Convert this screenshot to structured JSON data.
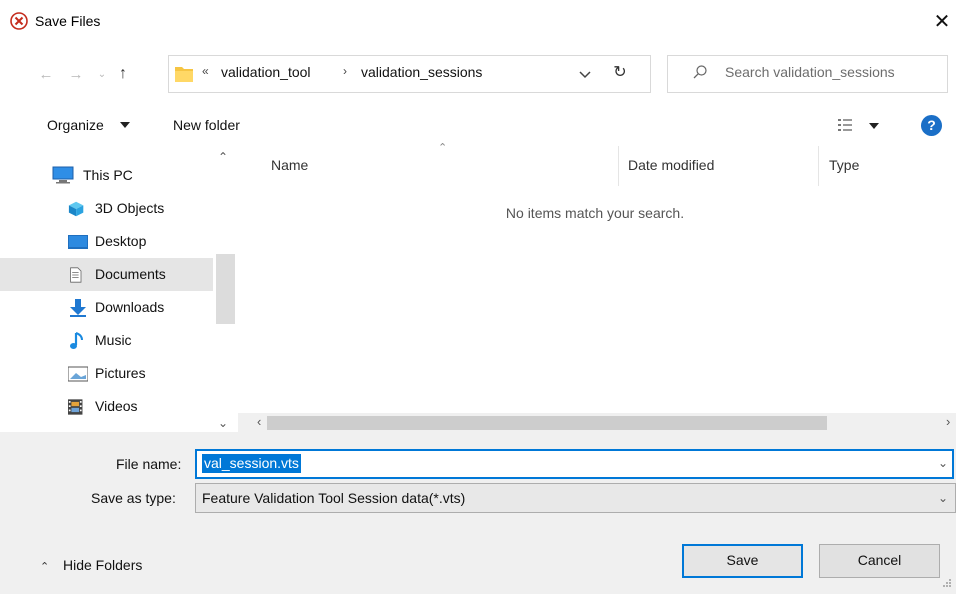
{
  "window": {
    "title": "Save Files",
    "close_glyph": "✕"
  },
  "address": {
    "overflow_glyph": "«",
    "crumbs": [
      "validation_tool",
      "validation_sessions"
    ],
    "separator": "›",
    "search_placeholder": "Search validation_sessions"
  },
  "toolbar": {
    "organize": "Organize",
    "new_folder": "New folder",
    "help": "?"
  },
  "nav": {
    "items": [
      {
        "label": "This PC",
        "icon": "this-pc-icon"
      },
      {
        "label": "3D Objects",
        "icon": "3d-objects-icon"
      },
      {
        "label": "Desktop",
        "icon": "desktop-icon"
      },
      {
        "label": "Documents",
        "icon": "documents-icon",
        "selected": true
      },
      {
        "label": "Downloads",
        "icon": "downloads-icon"
      },
      {
        "label": "Music",
        "icon": "music-icon"
      },
      {
        "label": "Pictures",
        "icon": "pictures-icon"
      },
      {
        "label": "Videos",
        "icon": "videos-icon"
      }
    ]
  },
  "filelist": {
    "columns": [
      "Name",
      "Date modified",
      "Type"
    ],
    "empty_message": "No items match your search."
  },
  "form": {
    "file_name_label": "File name:",
    "file_name_value": "val_session.vts",
    "save_type_label": "Save as type:",
    "save_type_value": "Feature Validation Tool Session data(*.vts)"
  },
  "footer": {
    "hide_folders": "Hide Folders",
    "save": "Save",
    "cancel": "Cancel"
  },
  "colors": {
    "accent": "#0078d7",
    "help": "#1b6fc7",
    "selected_nav": "#e5e5e5",
    "footer_bg": "#f0f0f0"
  }
}
